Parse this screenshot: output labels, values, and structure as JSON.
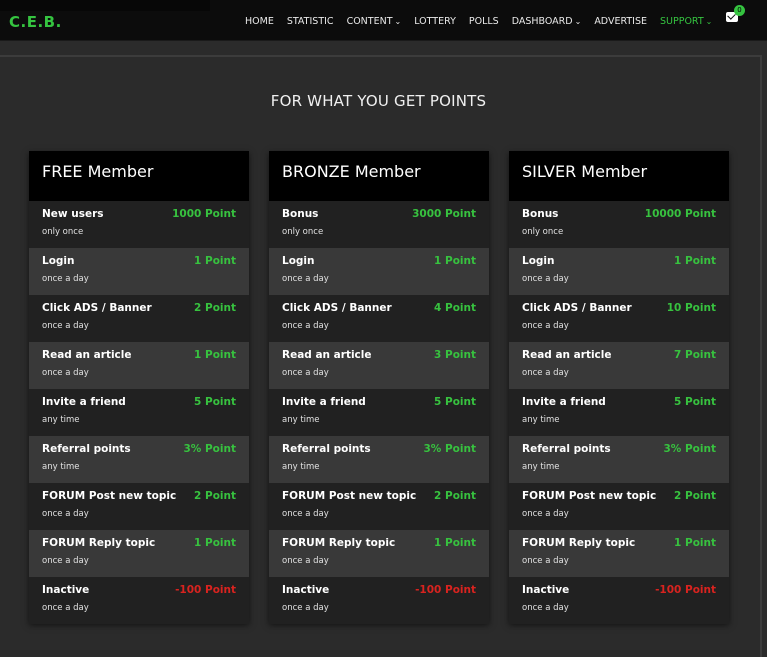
{
  "brand": {
    "logo": "C.E.B."
  },
  "nav": [
    {
      "label": "HOME",
      "dropdown": false,
      "active": false
    },
    {
      "label": "STATISTIC",
      "dropdown": false,
      "active": false
    },
    {
      "label": "CONTENT",
      "dropdown": true,
      "active": false
    },
    {
      "label": "LOTTERY",
      "dropdown": false,
      "active": false
    },
    {
      "label": "POLLS",
      "dropdown": false,
      "active": false
    },
    {
      "label": "DASHBOARD",
      "dropdown": true,
      "active": false
    },
    {
      "label": "ADVERTISE",
      "dropdown": false,
      "active": false
    },
    {
      "label": "SUPPORT",
      "dropdown": true,
      "active": true
    }
  ],
  "mail": {
    "count": "0",
    "icon": "envelope-icon"
  },
  "section": {
    "title": "FOR WHAT YOU GET POINTS"
  },
  "colors": {
    "accent": "#35c440",
    "negative": "#d9231f"
  },
  "cards": [
    {
      "title": "FREE Member",
      "rows": [
        {
          "label": "New users",
          "points": "1000 Point",
          "freq": "only once"
        },
        {
          "label": "Login",
          "points": "1 Point",
          "freq": "once a day"
        },
        {
          "label": "Click ADS / Banner",
          "points": "2 Point",
          "freq": "once a day"
        },
        {
          "label": "Read an article",
          "points": "1 Point",
          "freq": "once a day"
        },
        {
          "label": "Invite a friend",
          "points": "5 Point",
          "freq": "any time"
        },
        {
          "label": "Referral points",
          "points": "3% Point",
          "freq": "any time"
        },
        {
          "label": "FORUM Post new topic",
          "points": "2 Point",
          "freq": "once a day"
        },
        {
          "label": "FORUM Reply topic",
          "points": "1 Point",
          "freq": "once a day"
        },
        {
          "label": "Inactive",
          "points": "-100 Point",
          "freq": "once a day"
        }
      ]
    },
    {
      "title": "BRONZE Member",
      "rows": [
        {
          "label": "Bonus",
          "points": "3000 Point",
          "freq": "only once"
        },
        {
          "label": "Login",
          "points": "1 Point",
          "freq": "once a day"
        },
        {
          "label": "Click ADS / Banner",
          "points": "4 Point",
          "freq": "once a day"
        },
        {
          "label": "Read an article",
          "points": "3 Point",
          "freq": "once a day"
        },
        {
          "label": "Invite a friend",
          "points": "5 Point",
          "freq": "any time"
        },
        {
          "label": "Referral points",
          "points": "3% Point",
          "freq": "any time"
        },
        {
          "label": "FORUM Post new topic",
          "points": "2 Point",
          "freq": "once a day"
        },
        {
          "label": "FORUM Reply topic",
          "points": "1 Point",
          "freq": "once a day"
        },
        {
          "label": "Inactive",
          "points": "-100 Point",
          "freq": "once a day"
        }
      ]
    },
    {
      "title": "SILVER Member",
      "rows": [
        {
          "label": "Bonus",
          "points": "10000 Point",
          "freq": "only once"
        },
        {
          "label": "Login",
          "points": "1 Point",
          "freq": "once a day"
        },
        {
          "label": "Click ADS / Banner",
          "points": "10 Point",
          "freq": "once a day"
        },
        {
          "label": "Read an article",
          "points": "7 Point",
          "freq": "once a day"
        },
        {
          "label": "Invite a friend",
          "points": "5 Point",
          "freq": "any time"
        },
        {
          "label": "Referral points",
          "points": "3% Point",
          "freq": "any time"
        },
        {
          "label": "FORUM Post new topic",
          "points": "2 Point",
          "freq": "once a day"
        },
        {
          "label": "FORUM Reply topic",
          "points": "1 Point",
          "freq": "once a day"
        },
        {
          "label": "Inactive",
          "points": "-100 Point",
          "freq": "once a day"
        }
      ]
    }
  ]
}
